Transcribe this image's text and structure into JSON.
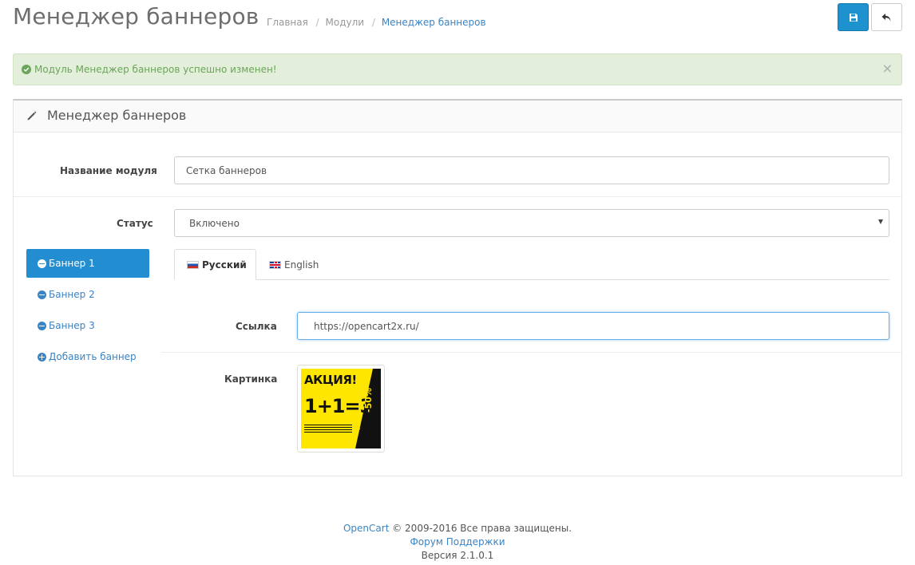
{
  "header": {
    "title": "Менеджер баннеров",
    "breadcrumb": [
      "Главная",
      "Модули",
      "Менеджер баннеров"
    ],
    "save_icon": "floppy-disk-icon",
    "back_icon": "reply-arrow-icon",
    "save_color": "#1e91cf"
  },
  "alert": {
    "message": "Модуль Менеджер баннеров успешно изменен!",
    "close": "×",
    "color": "#e3efda"
  },
  "panel": {
    "title": "Менеджер баннеров",
    "icon": "pencil-icon",
    "module_name_label": "Название модуля",
    "module_name_value": "Сетка баннеров",
    "status_label": "Статус",
    "status_value": "Включено"
  },
  "banners": {
    "items": [
      "Баннер 1",
      "Баннер 2",
      "Баннер 3"
    ],
    "add_label": "Добавить баннер",
    "active_index": 0
  },
  "tabs": {
    "items": [
      {
        "label": "Русский",
        "flag": "ru-flag-icon"
      },
      {
        "label": "English",
        "flag": "uk-flag-icon"
      }
    ]
  },
  "form": {
    "link_label": "Ссылка",
    "link_value": "https://opencart2x.ru/",
    "image_label": "Картинка"
  },
  "image": {
    "line1": "АКЦИЯ!",
    "line2": "1+1=3",
    "line3": "-50%"
  },
  "footer": {
    "brand": "OpenCart",
    "copyright": "© 2009-2016 Все права защищены.",
    "forum": "Форум Поддержки",
    "version": "Версия 2.1.0.1"
  }
}
